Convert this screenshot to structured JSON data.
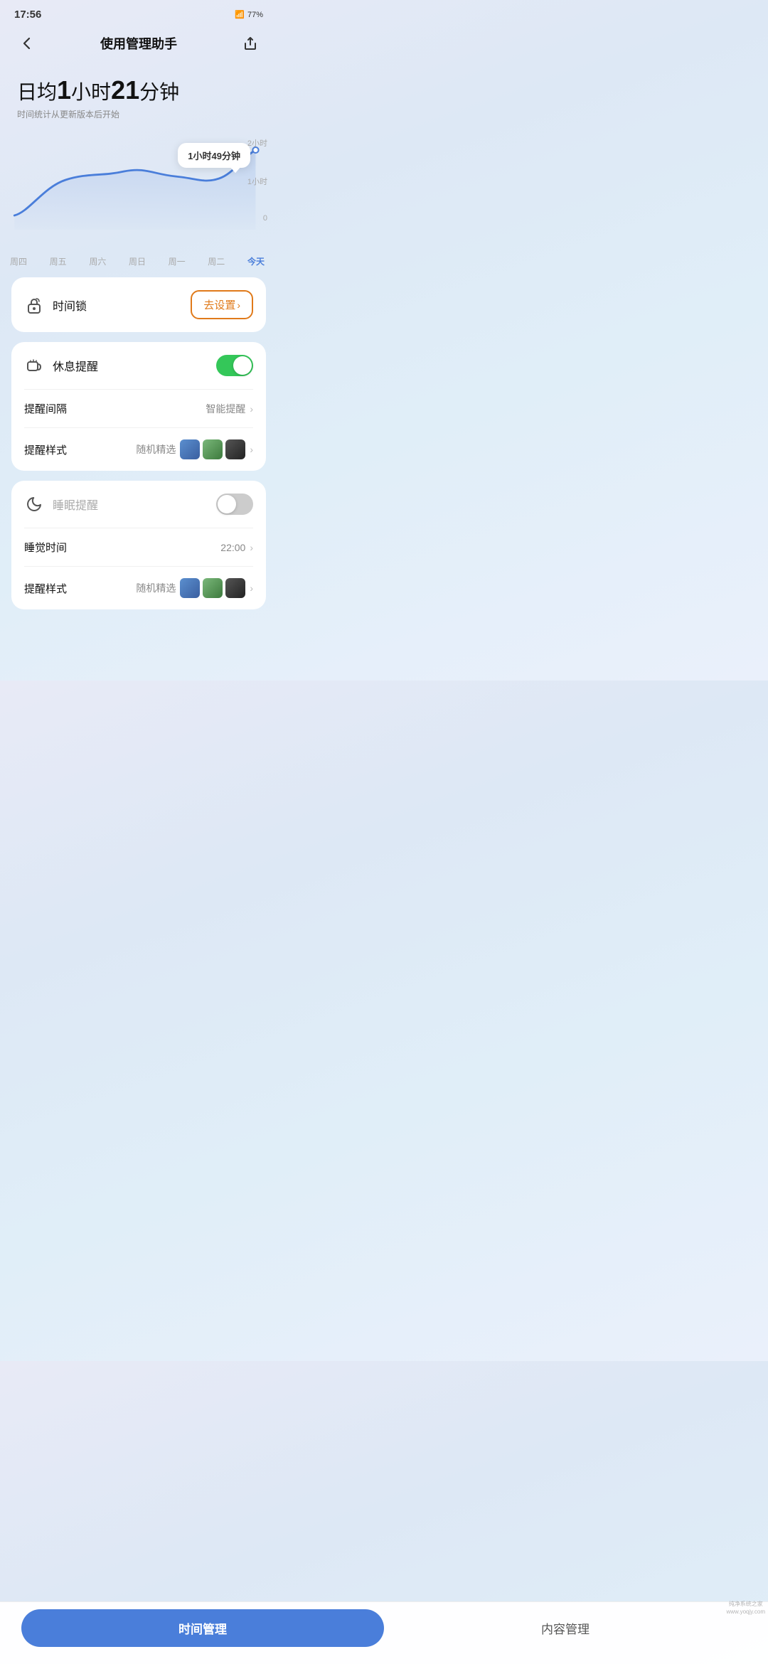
{
  "statusBar": {
    "time": "17:56",
    "battery": "77%"
  },
  "header": {
    "title": "使用管理助手",
    "backLabel": "‹",
    "shareLabel": "↗"
  },
  "dailyAvg": {
    "prefix": "日均",
    "hours": "1",
    "hoursUnit": "小时",
    "minutes": "21",
    "minutesUnit": "分钟",
    "subtitle": "时间统计从更新版本后开始"
  },
  "chart": {
    "tooltip": "1小时49分钟",
    "yLabels": [
      "2小时",
      "1小时",
      "0"
    ],
    "xLabels": [
      "周四",
      "周五",
      "周六",
      "周日",
      "周一",
      "周二",
      "今天"
    ]
  },
  "timeLockCard": {
    "icon": "⏰",
    "label": "时间锁",
    "btnLabel": "去设置",
    "btnArrow": "›"
  },
  "breakReminderCard": {
    "icon": "☕",
    "label": "休息提醒",
    "toggleOn": true,
    "rows": [
      {
        "label": "提醒间隔",
        "value": "智能提醒",
        "hasChevron": true,
        "hasThumbs": false
      },
      {
        "label": "提醒样式",
        "value": "随机精选",
        "hasChevron": true,
        "hasThumbs": true
      }
    ]
  },
  "sleepReminderCard": {
    "icon": "🌙",
    "label": "睡眠提醒",
    "toggleOn": false,
    "rows": [
      {
        "label": "睡觉时间",
        "value": "22:00",
        "hasChevron": true,
        "hasThumbs": false
      },
      {
        "label": "提醒样式",
        "value": "随机精选",
        "hasChevron": true,
        "hasThumbs": true
      }
    ]
  },
  "bottomNav": {
    "activeLabel": "时间管理",
    "inactiveLabel": "内容管理"
  }
}
